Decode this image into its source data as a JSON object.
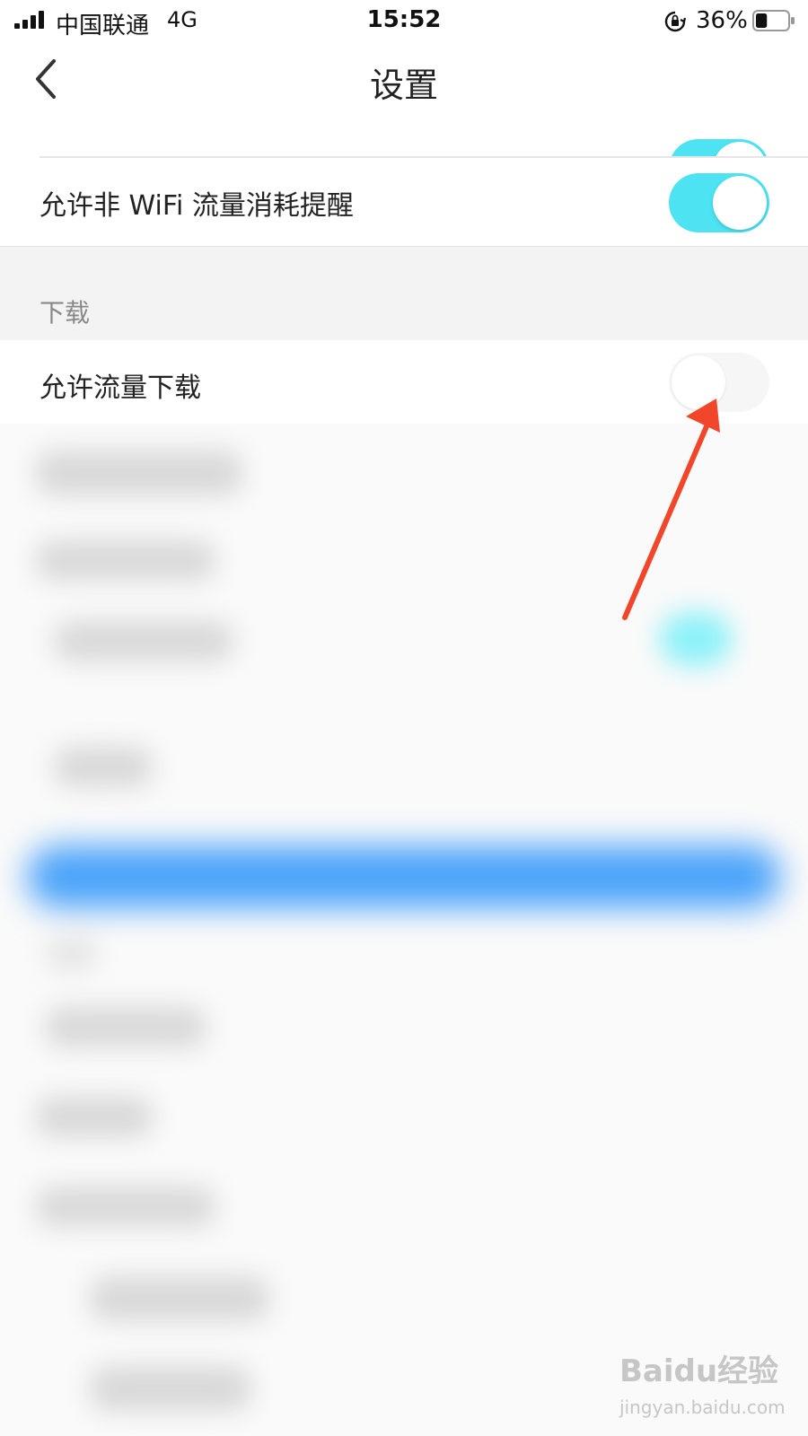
{
  "status_bar": {
    "carrier": "中国联通",
    "network": "4G",
    "time": "15:52",
    "battery_percent": "36%",
    "battery_level": 0.36
  },
  "nav": {
    "title": "设置",
    "back_icon": "chevron-left-icon"
  },
  "settings": {
    "partial_toggle_on": true,
    "wifi_reminder": {
      "label": "允许非 WiFi 流量消耗提醒",
      "enabled": true
    },
    "download_section": {
      "header": "下载"
    },
    "allow_data_download": {
      "label": "允许流量下载",
      "enabled": false
    }
  },
  "watermark": {
    "logo": "Baidu经验",
    "url": "jingyan.baidu.com"
  },
  "colors": {
    "toggle_on": "#4de3f2",
    "toggle_off": "#f6f6f6",
    "arrow": "#f2462a",
    "blurred_button": "#4aa3f9"
  }
}
